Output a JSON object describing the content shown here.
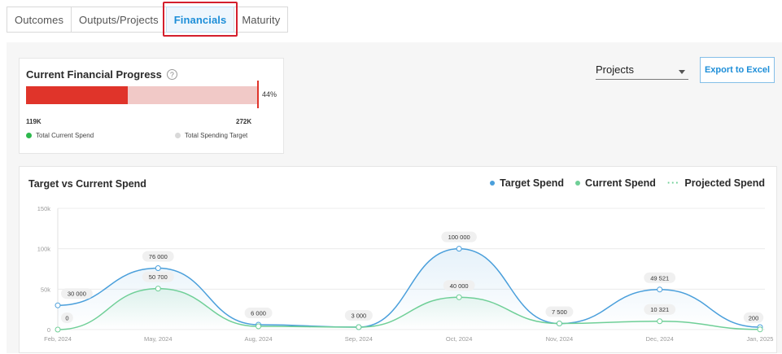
{
  "tabs": [
    {
      "label": "Outcomes"
    },
    {
      "label": "Outputs/Projects"
    },
    {
      "label": "Financials"
    },
    {
      "label": "Maturity"
    }
  ],
  "financial_progress": {
    "title": "Current Financial Progress",
    "help_icon": "question-circle-icon",
    "percent_label": "44%",
    "progress": 0.44,
    "current_spend_value": "119K",
    "target_value": "272K",
    "legend_current": "Total Current Spend",
    "legend_target": "Total Spending Target",
    "colors": {
      "fill": "#e0342a",
      "track": "#f1c9c7",
      "current_dot": "#2db84d",
      "target_dot": "#d9d9d9"
    }
  },
  "controls": {
    "dropdown_value": "Projects",
    "export_label": "Export to Excel"
  },
  "chart": {
    "title": "Target vs Current Spend",
    "legend": {
      "target": "Target Spend",
      "current": "Current Spend",
      "projected": "Projected Spend"
    },
    "colors": {
      "target": "#4a9fdb",
      "current": "#6fcf97",
      "projected": "#6fcf97"
    }
  },
  "chart_data": {
    "type": "line",
    "title": "Target vs Current Spend",
    "x": [
      "Feb, 2024",
      "May, 2024",
      "Aug, 2024",
      "Sep, 2024",
      "Oct, 2024",
      "Nov, 2024",
      "Dec, 2024",
      "Jan, 2025"
    ],
    "series": [
      {
        "name": "Target Spend",
        "values": [
          30000,
          76000,
          6000,
          3000,
          100000,
          7500,
          49521,
          3000
        ]
      },
      {
        "name": "Current Spend",
        "values": [
          0,
          50700,
          4000,
          3000,
          40000,
          7500,
          10321,
          200
        ]
      }
    ],
    "target_labels": [
      "30 000",
      "76 000",
      "6 000",
      "3 000",
      "100 000",
      "7 500",
      "49 521",
      ""
    ],
    "current_labels": [
      "0",
      "50 700",
      "",
      "",
      "40 000",
      "",
      "10 321",
      "200"
    ],
    "y_ticks": [
      "150k",
      "100k",
      "50k",
      "0"
    ],
    "y_tick_values": [
      150000,
      100000,
      50000,
      0
    ],
    "ylim": [
      0,
      150000
    ],
    "grid": true,
    "legend_position": "top-right"
  }
}
